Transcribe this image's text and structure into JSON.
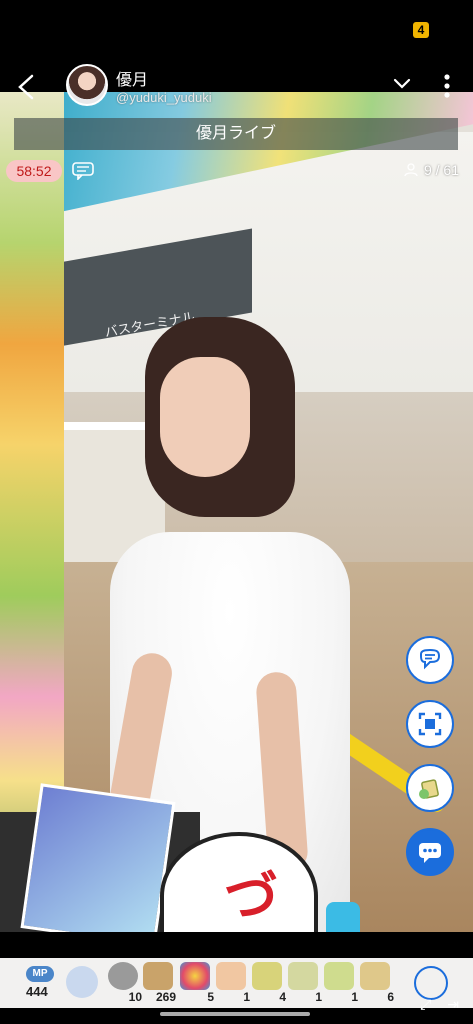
{
  "status": {
    "badge": "4"
  },
  "header": {
    "user_name": "優月",
    "user_handle": "@yuduki_yuduki",
    "live_title": "優月ライブ"
  },
  "live": {
    "elapsed": "58:52",
    "viewers": "9 / 61"
  },
  "scene": {
    "sign_text": "バスターミナル"
  },
  "actions": [
    {
      "icon": "comment-bubble-icon"
    },
    {
      "icon": "screenshot-frame-icon"
    },
    {
      "icon": "gift-bag-icon"
    },
    {
      "icon": "chat-dots-icon"
    }
  ],
  "giftbar": {
    "mp_label": "MP",
    "mp_value": "444",
    "gifts": [
      {
        "icon": "coin-icon",
        "count": "10"
      },
      {
        "icon": "house-icon",
        "count": "269"
      },
      {
        "icon": "firework-icon",
        "count": "5"
      },
      {
        "icon": "clap-icon",
        "count": "1"
      },
      {
        "icon": "seed-10-icon",
        "count": "4"
      },
      {
        "icon": "seed-icon",
        "count": "1"
      },
      {
        "icon": "seed-100-icon",
        "count": "1"
      },
      {
        "icon": "seed-1-icon",
        "count": "6"
      }
    ]
  },
  "colors": {
    "accent": "#1b6ddc",
    "timer_bg": "#f9c6c6",
    "timer_fg": "#c01a1a"
  }
}
